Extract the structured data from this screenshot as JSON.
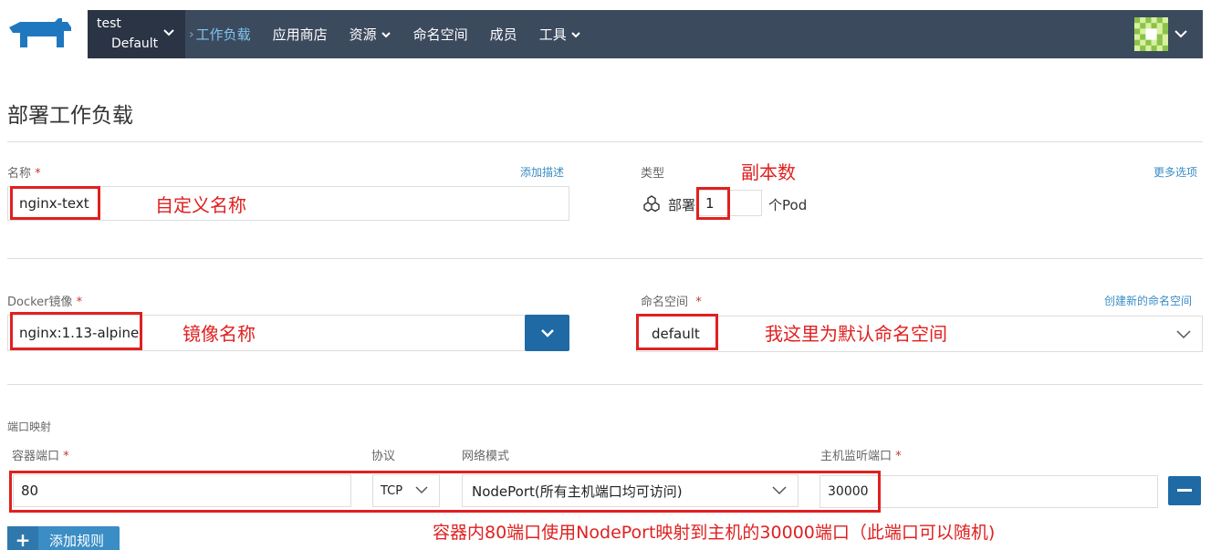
{
  "nav": {
    "project": "test",
    "namespace": "Default",
    "items": [
      {
        "label": "工作负载",
        "active": true,
        "dropdown": false
      },
      {
        "label": "应用商店",
        "active": false,
        "dropdown": false
      },
      {
        "label": "资源",
        "active": false,
        "dropdown": true
      },
      {
        "label": "命名空间",
        "active": false,
        "dropdown": false
      },
      {
        "label": "成员",
        "active": false,
        "dropdown": false
      },
      {
        "label": "工具",
        "active": false,
        "dropdown": true
      }
    ]
  },
  "page": {
    "title": "部署工作负载"
  },
  "form": {
    "name_label": "名称",
    "add_description": "添加描述",
    "name_value": "nginx-text",
    "type_label": "类型",
    "more_options": "更多选项",
    "deploy_label": "部署",
    "replicas_value": "1",
    "pod_unit": "个Pod",
    "image_label": "Docker镜像",
    "image_value": "nginx:1.13-alpine",
    "namespace_label": "命名空间",
    "create_namespace": "创建新的命名空间",
    "namespace_value": "default",
    "port_mapping_label": "端口映射",
    "container_port_label": "容器端口",
    "protocol_label": "协议",
    "network_mode_label": "网络模式",
    "host_port_label": "主机监听端口",
    "container_port_value": "80",
    "protocol_value": "TCP",
    "network_mode_value": "NodePort(所有主机端口均可访问)",
    "host_port_value": "30000",
    "add_rule": "添加规则",
    "required_mark": "*"
  },
  "annotations": {
    "custom_name": "自定义名称",
    "replicas": "副本数",
    "image_name": "镜像名称",
    "namespace_note": "我这里为默认命名空间",
    "port_note": "容器内80端口使用NodePort映射到主机的30000端口（此端口可以随机)"
  },
  "colors": {
    "topbar": "#3c4a5e",
    "env_bg": "#2a3445",
    "accent": "#3a8dc5",
    "annotation_red": "#e02020"
  }
}
